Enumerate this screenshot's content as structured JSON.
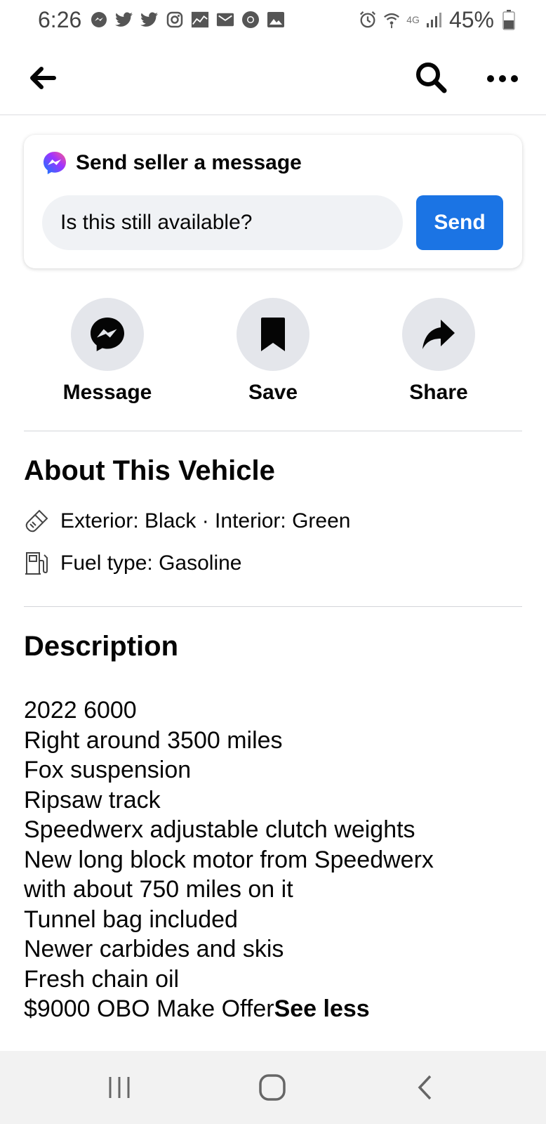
{
  "status_bar": {
    "time": "6:26",
    "network": "4G",
    "battery": "45%",
    "notification_icons": [
      "messenger-icon",
      "twitter-icon",
      "twitter-icon",
      "instagram-icon",
      "chart-icon",
      "mail-icon",
      "chrome-icon",
      "gallery-icon"
    ]
  },
  "header": {
    "back": "back-arrow-icon",
    "search": "search-icon",
    "more": "more-icon"
  },
  "message_card": {
    "title": "Send seller a message",
    "input_value": "Is this still available?",
    "send_label": "Send"
  },
  "actions": [
    {
      "label": "Message",
      "icon": "messenger-icon"
    },
    {
      "label": "Save",
      "icon": "bookmark-icon"
    },
    {
      "label": "Share",
      "icon": "share-icon"
    }
  ],
  "about": {
    "title": "About This Vehicle",
    "colors": "Exterior: Black · Interior: Green",
    "fuel": "Fuel type: Gasoline"
  },
  "description": {
    "title": "Description",
    "lines": [
      "2022 6000",
      "Right around 3500 miles",
      "Fox suspension",
      "Ripsaw track",
      "Speedwerx adjustable clutch weights",
      "New long block motor from Speedwerx",
      "with about 750 miles on it",
      "Tunnel bag included",
      "Newer carbides and skis",
      "Fresh chain oil",
      "$9000 OBO Make Offer"
    ],
    "see_less": "See less"
  },
  "colors": {
    "accent": "#1b74e4",
    "button_bg": "#e4e6eb",
    "input_bg": "#f0f2f5"
  }
}
